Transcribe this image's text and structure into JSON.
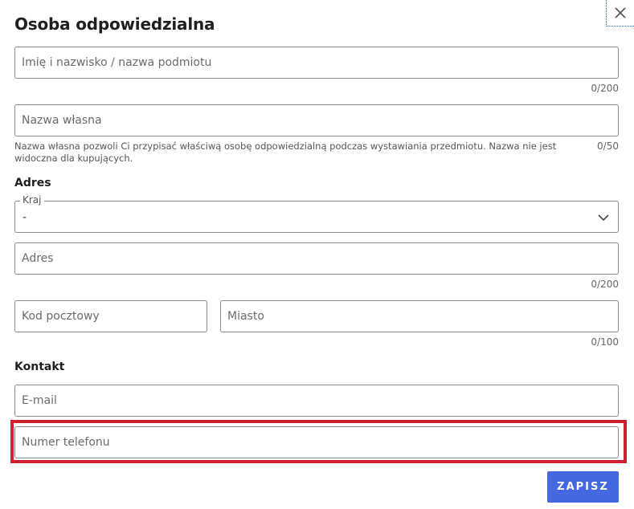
{
  "dialog": {
    "title": "Osoba odpowiedzialna",
    "close_icon": "close-icon"
  },
  "fields": {
    "name": {
      "placeholder": "Imię i nazwisko / nazwa podmiotu",
      "value": "",
      "counter": "0/200"
    },
    "own_name": {
      "placeholder": "Nazwa własna",
      "value": "",
      "counter": "0/50",
      "helper": "Nazwa własna pozwoli Ci przypisać właściwą osobę odpowiedzialną podczas wystawiania przedmiotu. Nazwa nie jest widoczna dla kupujących."
    }
  },
  "address": {
    "heading": "Adres",
    "country": {
      "label": "Kraj",
      "value": "-",
      "icon": "chevron-down-icon"
    },
    "street": {
      "placeholder": "Adres",
      "value": "",
      "counter": "0/200"
    },
    "postal_code": {
      "placeholder": "Kod pocztowy",
      "value": ""
    },
    "city": {
      "placeholder": "Miasto",
      "value": "",
      "counter": "0/100"
    }
  },
  "contact": {
    "heading": "Kontakt",
    "email": {
      "placeholder": "E-mail",
      "value": ""
    },
    "phone": {
      "placeholder": "Numer telefonu",
      "value": ""
    }
  },
  "actions": {
    "save_label": "ZAPISZ"
  },
  "colors": {
    "accent": "#4468e0",
    "highlight": "#d0202e",
    "border": "#8a8a8a"
  }
}
